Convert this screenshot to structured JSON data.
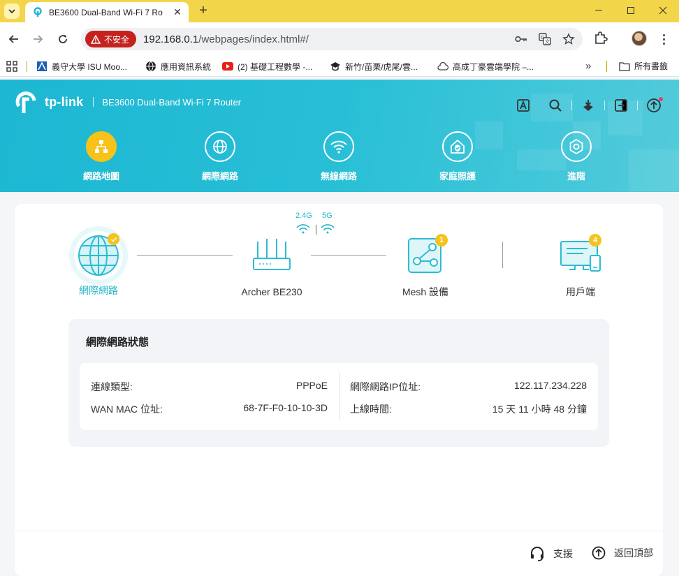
{
  "browser": {
    "tab": {
      "title": "BE3600 Dual-Band Wi-Fi 7 Ro"
    },
    "omnibox": {
      "security_label": "不安全",
      "url_host": "192.168.0.1",
      "url_path": "/webpages/index.html#/"
    },
    "bookmarks": [
      {
        "label": "義守大學 ISU Moo...",
        "icon": "isu-icon"
      },
      {
        "label": "應用資訊系統",
        "icon": "globe-icon"
      },
      {
        "label": "(2) 基礎工程數學 -...",
        "icon": "youtube-icon"
      },
      {
        "label": "新竹/苗栗/虎尾/雲...",
        "icon": "graduation-cap-icon"
      },
      {
        "label": "高成丁豪雲端學院 –...",
        "icon": "cloud-icon"
      }
    ],
    "bookmarks_all": "所有書籤",
    "colors": {
      "tabbar": "#f3d54a",
      "insecure": "#c5221f"
    }
  },
  "router": {
    "brand": "tp-link",
    "model": "BE3600 Dual-Band Wi-Fi 7 Router",
    "nav": [
      {
        "label": "網路地圖",
        "icon": "network-map-icon",
        "active": true
      },
      {
        "label": "網際網路",
        "icon": "globe-icon",
        "active": false
      },
      {
        "label": "無線網路",
        "icon": "wifi-icon",
        "active": false
      },
      {
        "label": "家庭照護",
        "icon": "home-shield-icon",
        "active": false
      },
      {
        "label": "進階",
        "icon": "gear-icon",
        "active": false
      }
    ],
    "colors": {
      "primary": "#1db7d3",
      "accent": "#f7c219"
    }
  },
  "topology": {
    "internet": {
      "label": "網際網路",
      "status": "connected"
    },
    "router": {
      "label": "Archer BE230",
      "band_24": "2.4G",
      "band_5": "5G"
    },
    "mesh": {
      "label": "Mesh 設備",
      "count": "1"
    },
    "clients": {
      "label": "用戶端",
      "count": "4"
    }
  },
  "status": {
    "title": "網際網路狀態",
    "conn_type_label": "連線類型:",
    "conn_type_value": "PPPoE",
    "wan_mac_label": "WAN MAC 位址:",
    "wan_mac_value": "68-7F-F0-10-10-3D",
    "ip_label": "網際網路IP位址:",
    "ip_value": "122.117.234.228",
    "uptime_label": "上線時間:",
    "uptime_value": "15 天 11 小時 48 分鐘"
  },
  "footer": {
    "support": "支援",
    "back_to_top": "返回頂部"
  }
}
